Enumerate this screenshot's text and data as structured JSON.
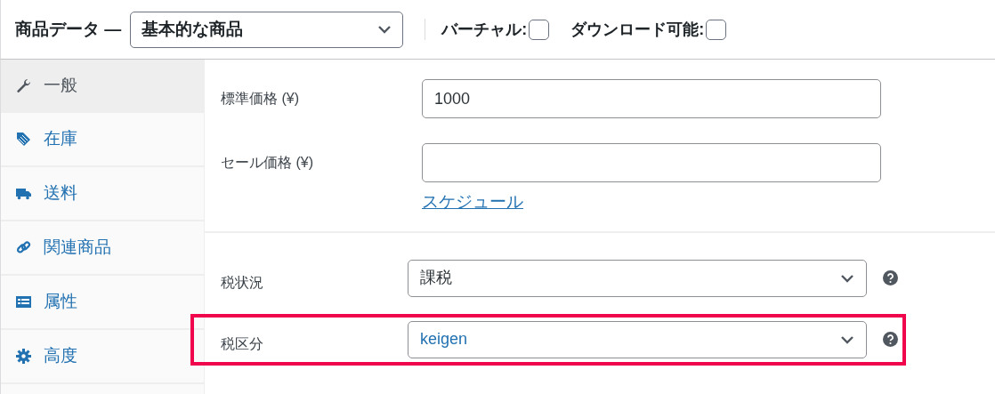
{
  "header": {
    "title": "商品データ —",
    "product_type": {
      "value": "基本的な商品"
    },
    "options": [
      {
        "label": "バーチャル:",
        "checked": false
      },
      {
        "label": "ダウンロード可能:",
        "checked": false
      }
    ]
  },
  "tabs": [
    {
      "label": "一般",
      "kind": "wrench",
      "selected": true
    },
    {
      "label": "在庫",
      "kind": "tag",
      "selected": false
    },
    {
      "label": "送料",
      "kind": "truck",
      "selected": false
    },
    {
      "label": "関連商品",
      "kind": "link",
      "selected": false
    },
    {
      "label": "属性",
      "kind": "list",
      "selected": false
    },
    {
      "label": "高度",
      "kind": "gear",
      "selected": false
    }
  ],
  "price_fields": [
    {
      "label": "標準価格 (¥)",
      "value": "1000"
    },
    {
      "label": "セール価格 (¥)"
    }
  ],
  "schedule_link": "スケジュール",
  "tax_fields": [
    {
      "label": "税状況",
      "value": "課税",
      "focused": false,
      "highlighted": false
    },
    {
      "label": "税区分",
      "value": "keigen",
      "focused": true,
      "highlighted": true
    }
  ]
}
